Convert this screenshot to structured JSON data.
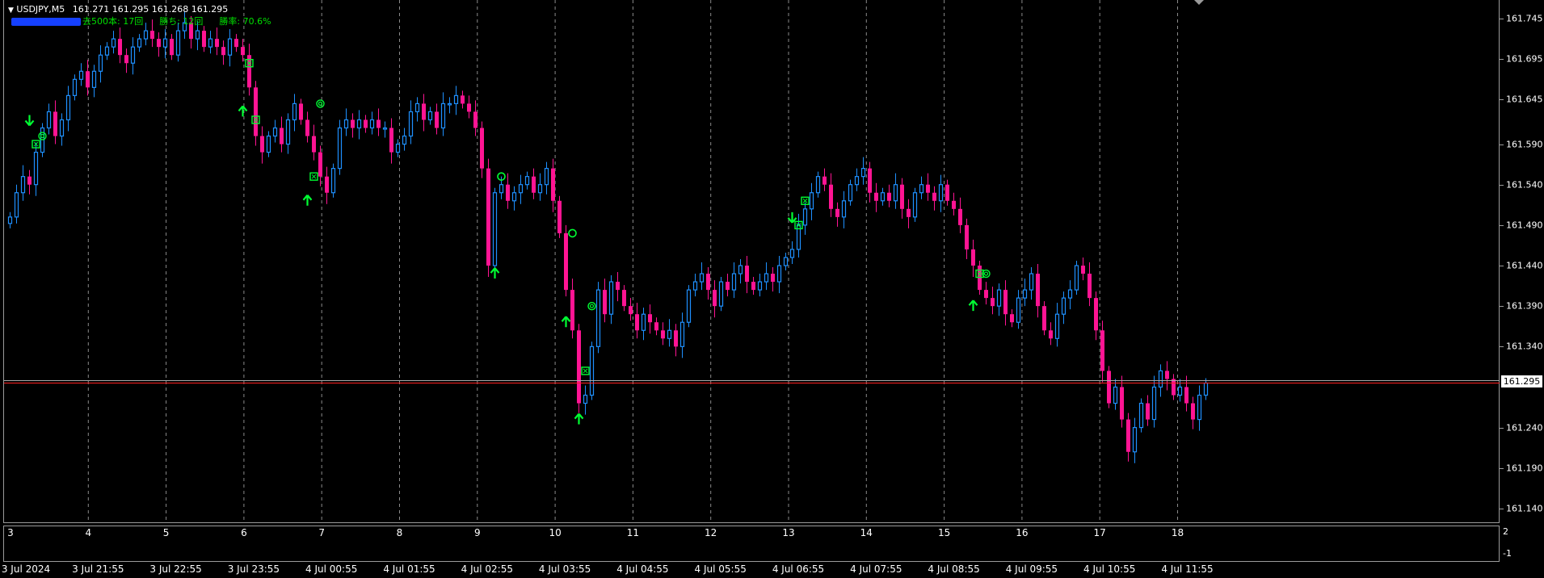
{
  "header": {
    "symbol": "USDJPY,M5",
    "ohlc": "161.271 161.295 161.268 161.295",
    "stat_bars": "去500本: 17回",
    "stat_wins": "勝ち: 12回",
    "stat_rate": "勝率: 70.6%"
  },
  "colors": {
    "bull": "#1e90ff",
    "bear": "#ff1493",
    "signal": "#00ff33",
    "bid_line": "#ff2020",
    "ask_line": "#aaaaaa"
  },
  "current_price": "161.295",
  "sub_window": {
    "top_label": "2",
    "bottom_label": "-1"
  },
  "price_axis": [
    {
      "label": "161.745",
      "value": 161.745
    },
    {
      "label": "161.695",
      "value": 161.695
    },
    {
      "label": "161.645",
      "value": 161.645
    },
    {
      "label": "161.590",
      "value": 161.59
    },
    {
      "label": "161.540",
      "value": 161.54
    },
    {
      "label": "161.490",
      "value": 161.49
    },
    {
      "label": "161.440",
      "value": 161.44
    },
    {
      "label": "161.390",
      "value": 161.39
    },
    {
      "label": "161.340",
      "value": 161.34
    },
    {
      "label": "161.240",
      "value": 161.24
    },
    {
      "label": "161.190",
      "value": 161.19
    },
    {
      "label": "161.140",
      "value": 161.14
    }
  ],
  "index_labels": [
    "3",
    "4",
    "5",
    "6",
    "7",
    "8",
    "9",
    "10",
    "11",
    "12",
    "13",
    "14",
    "15",
    "16",
    "17",
    "18"
  ],
  "time_labels": [
    "3 Jul 2024",
    "3 Jul 21:55",
    "3 Jul 22:55",
    "3 Jul 23:55",
    "4 Jul 00:55",
    "4 Jul 01:55",
    "4 Jul 02:55",
    "4 Jul 03:55",
    "4 Jul 04:55",
    "4 Jul 05:55",
    "4 Jul 06:55",
    "4 Jul 07:55",
    "4 Jul 08:55",
    "4 Jul 09:55",
    "4 Jul 10:55",
    "4 Jul 11:55"
  ],
  "chart_data": {
    "type": "candlestick",
    "symbol": "USDJPY,M5",
    "ylim": [
      161.125,
      161.765
    ],
    "bid": 161.295,
    "ask": 161.298,
    "closes": [
      161.5,
      161.53,
      161.55,
      161.54,
      161.58,
      161.61,
      161.63,
      161.6,
      161.62,
      161.65,
      161.67,
      161.68,
      161.66,
      161.68,
      161.7,
      161.71,
      161.72,
      161.7,
      161.69,
      161.71,
      161.72,
      161.73,
      161.72,
      161.71,
      161.72,
      161.7,
      161.73,
      161.74,
      161.72,
      161.73,
      161.71,
      161.72,
      161.71,
      161.7,
      161.72,
      161.71,
      161.7,
      161.66,
      161.6,
      161.58,
      161.6,
      161.61,
      161.59,
      161.62,
      161.64,
      161.62,
      161.6,
      161.58,
      161.55,
      161.53,
      161.56,
      161.61,
      161.62,
      161.61,
      161.62,
      161.61,
      161.62,
      161.61,
      161.61,
      161.58,
      161.59,
      161.6,
      161.63,
      161.64,
      161.62,
      161.63,
      161.61,
      161.64,
      161.64,
      161.65,
      161.64,
      161.63,
      161.61,
      161.56,
      161.44,
      161.53,
      161.54,
      161.52,
      161.53,
      161.54,
      161.55,
      161.53,
      161.54,
      161.56,
      161.52,
      161.48,
      161.41,
      161.36,
      161.27,
      161.28,
      161.34,
      161.41,
      161.38,
      161.42,
      161.41,
      161.39,
      161.38,
      161.36,
      161.38,
      161.37,
      161.36,
      161.35,
      161.36,
      161.34,
      161.37,
      161.41,
      161.42,
      161.43,
      161.41,
      161.39,
      161.42,
      161.41,
      161.43,
      161.44,
      161.42,
      161.41,
      161.42,
      161.43,
      161.42,
      161.44,
      161.45,
      161.46,
      161.49,
      161.51,
      161.53,
      161.55,
      161.54,
      161.51,
      161.5,
      161.52,
      161.54,
      161.55,
      161.56,
      161.53,
      161.52,
      161.53,
      161.52,
      161.54,
      161.51,
      161.5,
      161.53,
      161.54,
      161.53,
      161.52,
      161.54,
      161.52,
      161.51,
      161.49,
      161.46,
      161.44,
      161.41,
      161.4,
      161.39,
      161.41,
      161.38,
      161.37,
      161.4,
      161.41,
      161.43,
      161.39,
      161.36,
      161.35,
      161.38,
      161.4,
      161.41,
      161.44,
      161.43,
      161.4,
      161.36,
      161.31,
      161.27,
      161.29,
      161.25,
      161.21,
      161.24,
      161.27,
      161.25,
      161.29,
      161.31,
      161.3,
      161.28,
      161.29,
      161.27,
      161.25,
      161.28,
      161.295
    ],
    "signals": [
      {
        "bar": 3,
        "kind": "arrow-down",
        "price": 161.62
      },
      {
        "bar": 4,
        "kind": "box",
        "price": 161.59
      },
      {
        "bar": 5,
        "kind": "double-circle",
        "price": 161.6
      },
      {
        "bar": 36,
        "kind": "arrow-up",
        "price": 161.63
      },
      {
        "bar": 37,
        "kind": "box",
        "price": 161.69
      },
      {
        "bar": 38,
        "kind": "box",
        "price": 161.62
      },
      {
        "bar": 46,
        "kind": "arrow-up",
        "price": 161.52
      },
      {
        "bar": 47,
        "kind": "box",
        "price": 161.55
      },
      {
        "bar": 48,
        "kind": "double-circle",
        "price": 161.64
      },
      {
        "bar": 75,
        "kind": "arrow-up",
        "price": 161.43
      },
      {
        "bar": 76,
        "kind": "circle",
        "price": 161.55
      },
      {
        "bar": 86,
        "kind": "arrow-up",
        "price": 161.37
      },
      {
        "bar": 87,
        "kind": "circle",
        "price": 161.48
      },
      {
        "bar": 88,
        "kind": "arrow-up",
        "price": 161.25
      },
      {
        "bar": 89,
        "kind": "box",
        "price": 161.31
      },
      {
        "bar": 90,
        "kind": "double-circle",
        "price": 161.39
      },
      {
        "bar": 121,
        "kind": "arrow-down",
        "price": 161.5
      },
      {
        "bar": 122,
        "kind": "box",
        "price": 161.49
      },
      {
        "bar": 123,
        "kind": "box",
        "price": 161.52
      },
      {
        "bar": 149,
        "kind": "arrow-up",
        "price": 161.39
      },
      {
        "bar": 150,
        "kind": "box",
        "price": 161.43
      },
      {
        "bar": 151,
        "kind": "double-circle",
        "price": 161.43
      }
    ]
  }
}
